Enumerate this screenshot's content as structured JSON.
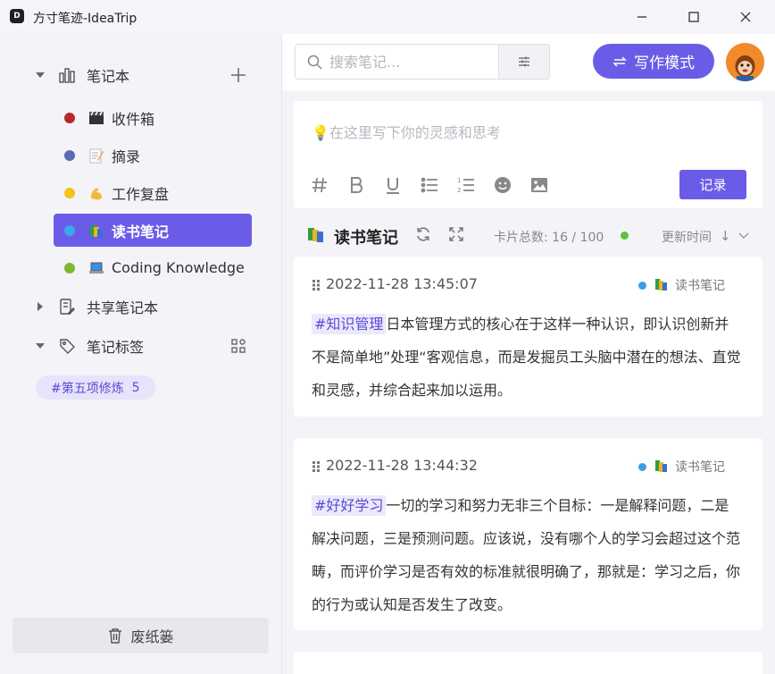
{
  "window": {
    "title": "方寸笔迹-IdeaTrip",
    "logo_letter": "D"
  },
  "sidebar": {
    "notebooks_label": "笔记本",
    "notebooks": [
      {
        "label": "收件箱",
        "dot_color": "#b8282a",
        "emoji": "🎬"
      },
      {
        "label": "摘录",
        "dot_color": "#5b6bb0",
        "emoji": "📝"
      },
      {
        "label": "工作复盘",
        "dot_color": "#f4c21a",
        "emoji": "💪"
      },
      {
        "label": "读书笔记",
        "dot_color": "#3da6e8",
        "emoji": "📚",
        "active": true
      },
      {
        "label": "Coding Knowledge",
        "dot_color": "#7cb930",
        "emoji": "💻"
      }
    ],
    "shared_label": "共享笔记本",
    "tags_label": "笔记标签",
    "tags": [
      {
        "label": "#第五项修炼",
        "count": "5"
      }
    ],
    "trash_label": "废纸篓"
  },
  "topbar": {
    "search_placeholder": "搜索笔记...",
    "write_mode_label": "写作模式"
  },
  "editor": {
    "placeholder": "💡在这里写下你的灵感和思考",
    "record_label": "记录"
  },
  "list_header": {
    "title": "读书笔记",
    "count_text": "卡片总数: 16 / 100",
    "sort_label": "更新时间",
    "sort_arrow": "↓"
  },
  "cards": [
    {
      "time": "2022-11-28 13:45:07",
      "notebook": "读书笔记",
      "tag": "#知识管理",
      "text": "日本管理方式的核心在于这样一种认识，即认识创新并不是简单地”处理“客观信息，而是发掘员工头脑中潜在的想法、直觉和灵感，并综合起来加以运用。"
    },
    {
      "time": "2022-11-28 13:44:32",
      "notebook": "读书笔记",
      "tag": "#好好学习",
      "text": "一切的学习和努力无非三个目标：一是解释问题，二是解决问题，三是预测问题。应该说，没有哪个人的学习会超过这个范畴，而评价学习是否有效的标准就很明确了，那就是：学习之后，你的行为或认知是否发生了改变。"
    }
  ],
  "colors": {
    "accent": "#6b5ce7",
    "tag_bg": "#ebe9fb",
    "sync_dot": "#5cc43a"
  }
}
